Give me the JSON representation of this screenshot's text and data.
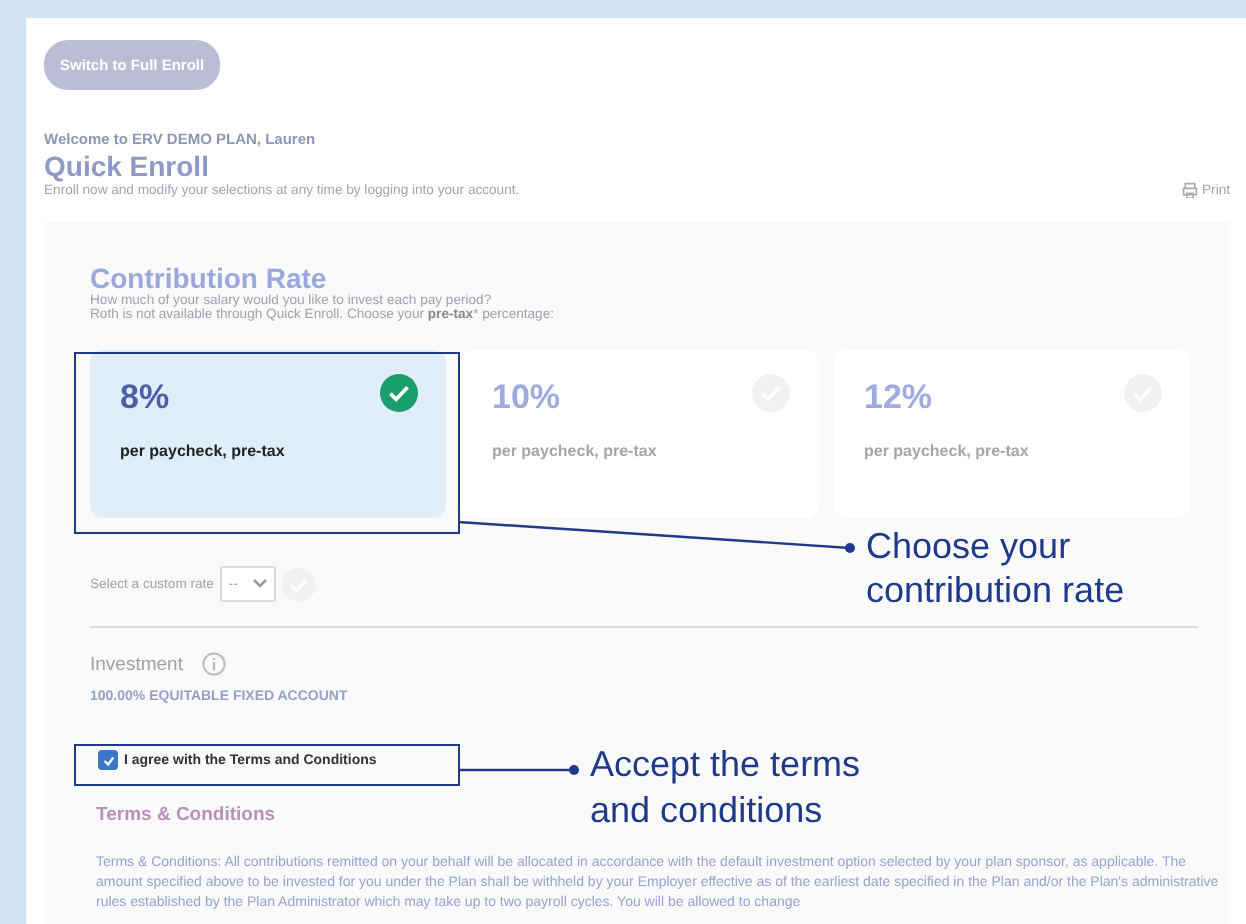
{
  "switch_button": "Switch to Full Enroll",
  "welcome": "Welcome to ERV DEMO PLAN, Lauren",
  "title": "Quick Enroll",
  "subtitle": "Enroll now and modify your selections at any time by logging into your account.",
  "print": "Print",
  "contribution": {
    "heading": "Contribution Rate",
    "question": "How much of your salary would you like to invest each pay period?",
    "note": "Roth is not available through Quick Enroll. Choose your **pre-tax*** percentage:",
    "options": [
      {
        "rate": "8%",
        "caption": "per paycheck, pre-tax",
        "selected": true
      },
      {
        "rate": "10%",
        "caption": "per paycheck, pre-tax",
        "selected": false
      },
      {
        "rate": "12%",
        "caption": "per paycheck, pre-tax",
        "selected": false
      }
    ],
    "custom_label": "Select a custom rate",
    "custom_value": "--"
  },
  "investment": {
    "heading": "Investment",
    "account": "100.00% EQUITABLE FIXED ACCOUNT"
  },
  "agree": {
    "label": "I agree with the Terms and Conditions",
    "checked": true
  },
  "terms": {
    "heading": "Terms & Conditions",
    "text": "Terms & Conditions: All contributions remitted on your behalf will be allocated in accordance with the default investment option selected by your plan sponsor, as applicable. The amount specified above to be invested for you under the Plan shall be withheld by your Employer effective as of the earliest date specified in the Plan and/or the Plan's administrative rules established by the Plan Administrator which may take up to two payroll cycles. You will be allowed to change"
  },
  "callouts": [
    {
      "text": "Choose your contribution rate"
    },
    {
      "text": "Accept the terms and conditions"
    }
  ]
}
